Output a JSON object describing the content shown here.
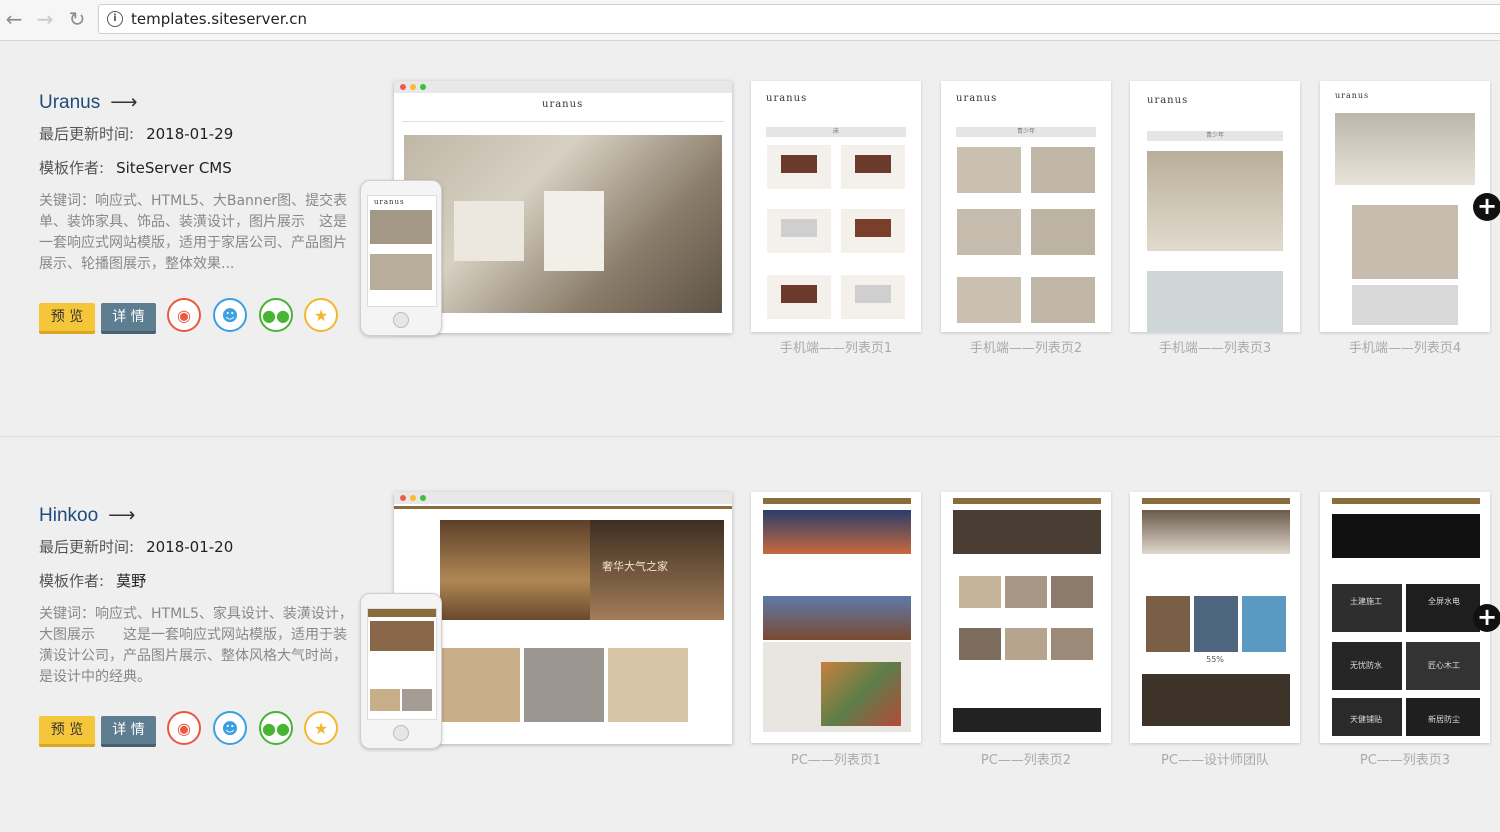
{
  "browser": {
    "back_icon": "back-arrow-icon",
    "forward_icon": "forward-arrow-icon",
    "reload_icon": "reload-icon",
    "url": "templates.siteserver.cn"
  },
  "templates": [
    {
      "name": "Uranus",
      "updated_label": "最后更新时间:",
      "updated_value": "2018-01-29",
      "author_label": "模板作者:",
      "author_value": "SiteServer CMS",
      "description": "关键词：响应式、HTML5、大Banner图、提交表单、装饰家具、饰品、装潢设计，图片展示　这是一套响应式网站模版，适用于家居公司、产品图片展示、轮播图展示，整体效果...",
      "preview_label": "预 览",
      "detail_label": "详 情",
      "thumbs": [
        "手机端——列表页1",
        "手机端——列表页2",
        "手机端——列表页3",
        "手机端——列表页4"
      ],
      "brand": "uranus",
      "mobile_tags": [
        "床",
        "青少年",
        "青少年"
      ]
    },
    {
      "name": "Hinkoo",
      "updated_label": "最后更新时间:",
      "updated_value": "2018-01-20",
      "author_label": "模板作者:",
      "author_value": "莫野",
      "description": "关键词：响应式、HTML5、家具设计、装潢设计，大图展示　　这是一套响应式网站模版，适用于装潢设计公司，产品图片展示、整体风格大气时尚，是设计中的经典。",
      "preview_label": "预 览",
      "detail_label": "详 情",
      "thumbs": [
        "PC——列表页1",
        "PC——列表页2",
        "PC——设计师团队",
        "PC——列表页3"
      ],
      "banner_text": "奢华大气之家",
      "percent_text": "55%",
      "tiles": [
        "土建施工",
        "全屏水电",
        "无忧防水",
        "匠心木工",
        "天健铺贴",
        "新居防尘"
      ]
    }
  ],
  "colors": {
    "title": "#1f4c7a",
    "preview_button": "#f5c63a",
    "detail_button": "#5e7d91",
    "weibo": "#e9593f",
    "qq": "#3aa0e0",
    "wechat": "#48b434",
    "favorite": "#f2b72f"
  }
}
